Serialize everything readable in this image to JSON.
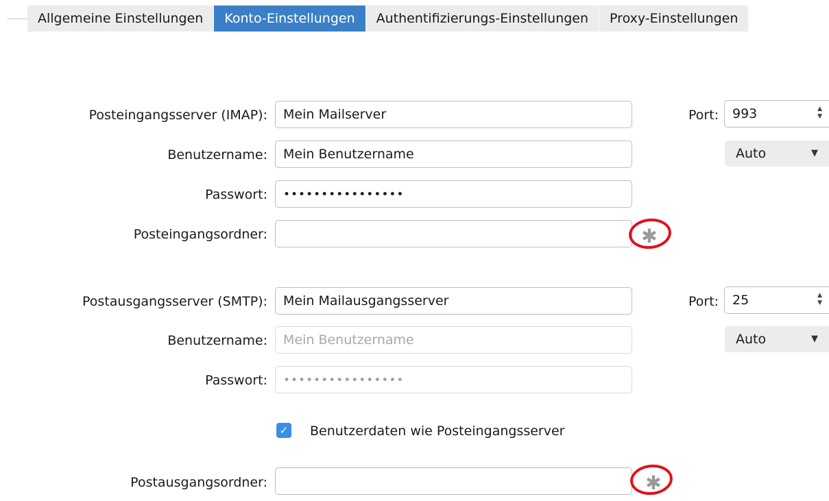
{
  "tabs": [
    {
      "label": "Allgemeine Einstellungen",
      "active": false
    },
    {
      "label": "Konto-Einstellungen",
      "active": true
    },
    {
      "label": "Authentifizierungs-Einstellungen",
      "active": false
    },
    {
      "label": "Proxy-Einstellungen",
      "active": false
    }
  ],
  "incoming": {
    "server_label": "Posteingangsserver (IMAP):",
    "server_value": "Mein Mailserver",
    "user_label": "Benutzername:",
    "user_value": "Mein Benutzername",
    "password_label": "Passwort:",
    "password_value": "••••••••••••••••",
    "folder_label": "Posteingangsordner:",
    "folder_value": "",
    "port_label": "Port:",
    "port_value": "993",
    "security_value": "Auto"
  },
  "outgoing": {
    "server_label": "Postausgangsserver (SMTP):",
    "server_value": "Mein Mailausgangsserver",
    "user_label": "Benutzername:",
    "user_value": "Mein Benutzername",
    "password_label": "Passwort:",
    "password_value": "••••••••••••••••",
    "same_credentials_label": "Benutzerdaten wie Posteingangsserver",
    "same_credentials_checked": true,
    "folder_label": "Postausgangsordner:",
    "folder_value": "",
    "port_label": "Port:",
    "port_value": "25",
    "security_value": "Auto"
  },
  "icons": {
    "folder_picker": "gear-icon",
    "highlight": "red-circle-annotation",
    "checkbox": "checkmark-icon",
    "spinner": "up-down-arrows-icon",
    "dropdown": "chevron-down-icon"
  },
  "colors": {
    "accent": "#3b80c7",
    "checkbox": "#3b8ee6",
    "annotation": "#e0121b"
  }
}
